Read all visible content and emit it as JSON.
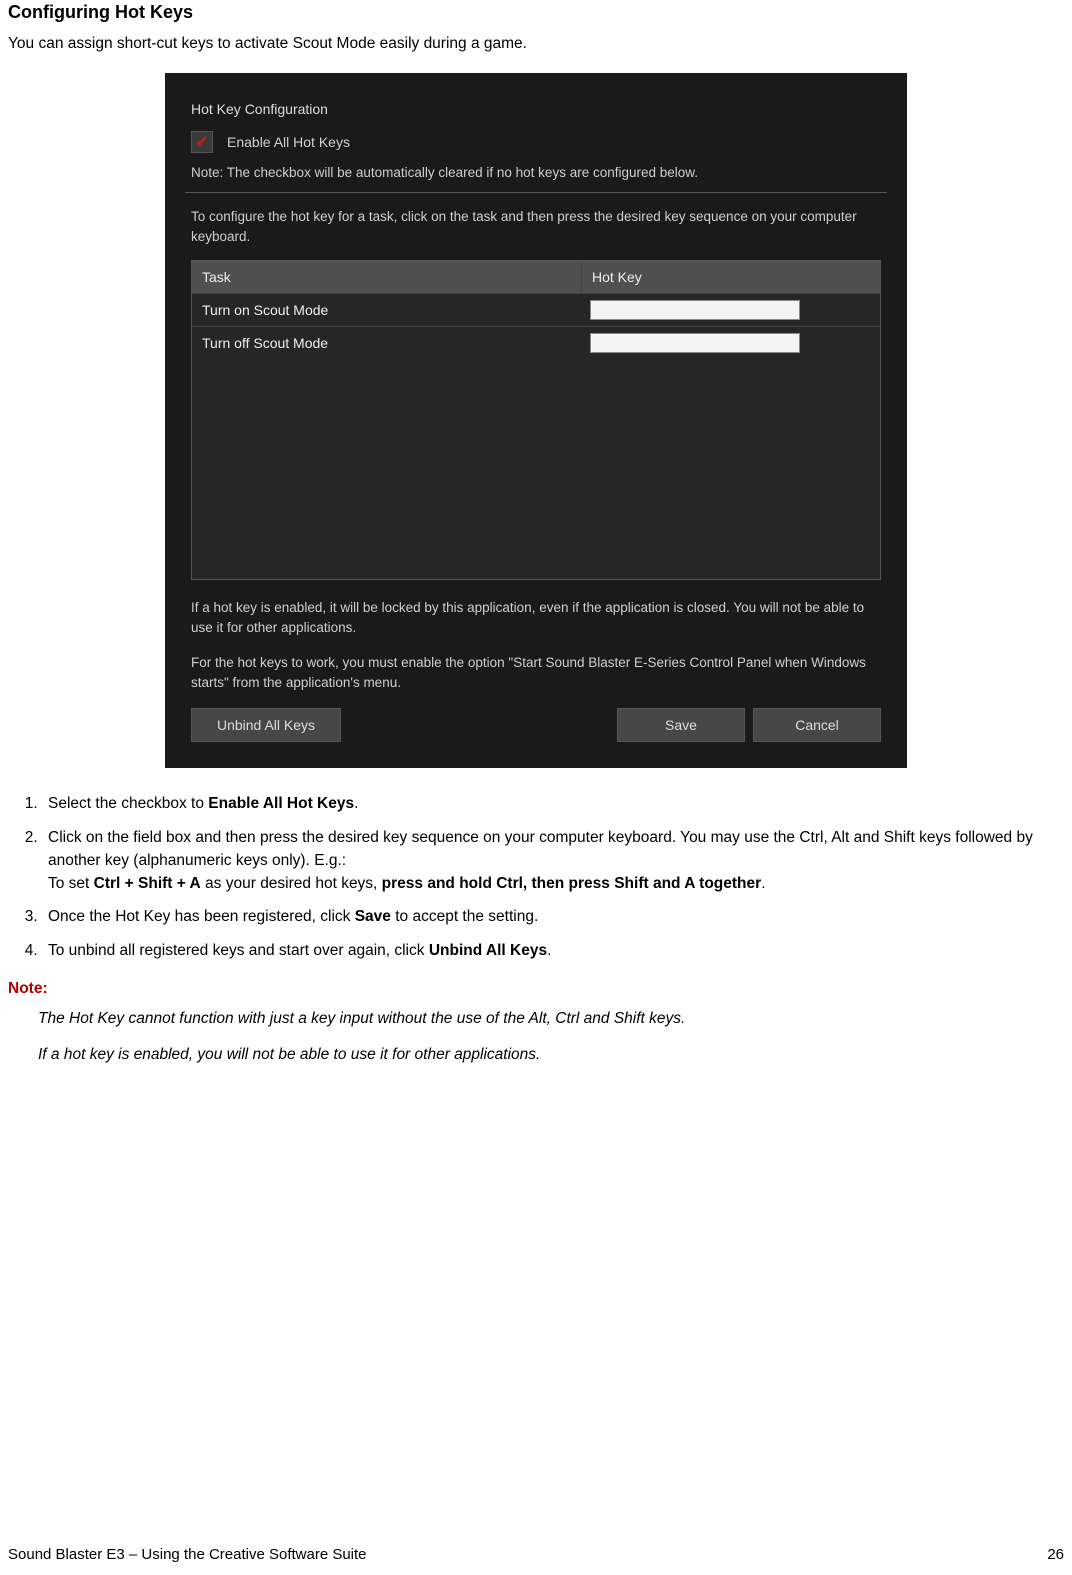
{
  "page": {
    "title": "Configuring Hot Keys",
    "intro": "You can assign short-cut keys to activate Scout Mode easily during a game."
  },
  "dialog": {
    "heading": "Hot Key Configuration",
    "enable_label": "Enable All Hot Keys",
    "note": "Note: The checkbox will be automatically cleared if no hot keys are configured below.",
    "instruct": "To configure the hot key for a task, click on the task and then press the desired key sequence on your computer keyboard.",
    "columns": {
      "task": "Task",
      "hotkey": "Hot Key"
    },
    "rows": [
      {
        "task": "Turn on Scout Mode",
        "hotkey": ""
      },
      {
        "task": "Turn off Scout Mode",
        "hotkey": ""
      }
    ],
    "warn1": "If a hot key is enabled, it will be locked by this application, even if the application is closed. You will not be able to use it for other applications.",
    "warn2": "For the hot keys to work, you must enable the option \"Start Sound Blaster E-Series Control Panel when Windows starts\" from the application's menu.",
    "buttons": {
      "unbind": "Unbind All Keys",
      "save": "Save",
      "cancel": "Cancel"
    }
  },
  "steps": {
    "s1a": "Select the checkbox to ",
    "s1b": "Enable All Hot Keys",
    "s1c": ".",
    "s2a": "Click on the field box and then press the desired key sequence on your computer keyboard. You may use the Ctrl, Alt and Shift keys followed by another key (alphanumeric keys only). E.g.:",
    "s2b": "To set ",
    "s2c": "Ctrl + Shift + A",
    "s2d": " as your desired hot keys, ",
    "s2e": "press and hold Ctrl, then press Shift and A together",
    "s2f": ".",
    "s3a": "Once the Hot Key has been registered, click ",
    "s3b": "Save",
    "s3c": " to accept the setting.",
    "s4a": "To unbind all registered keys and start over again, click ",
    "s4b": "Unbind All Keys",
    "s4c": "."
  },
  "note": {
    "header": "Note:",
    "line1": "The Hot Key cannot function with just a key input without the use of the Alt, Ctrl and Shift keys.",
    "line2": "If a hot key is enabled, you will not be able to use it for other applications."
  },
  "footer": {
    "left": "Sound Blaster E3 – Using the Creative Software Suite",
    "right": "26"
  }
}
